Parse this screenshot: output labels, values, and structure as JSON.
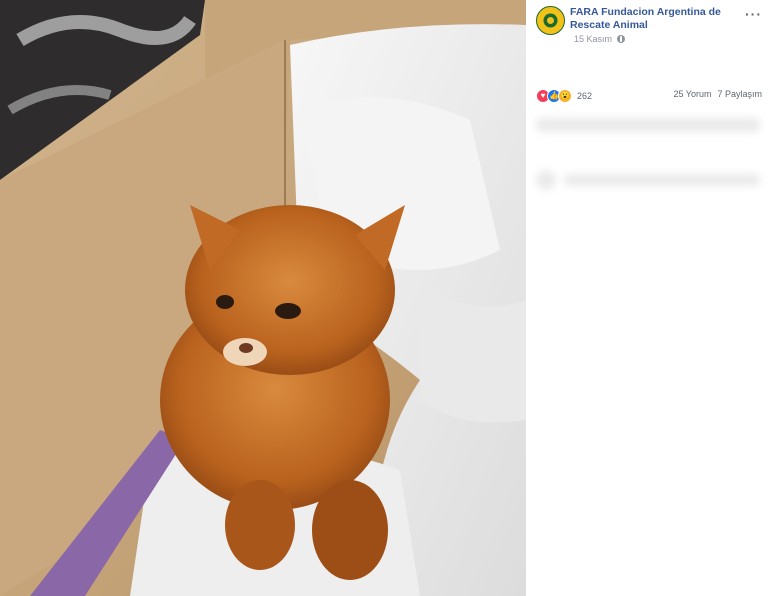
{
  "post": {
    "page_name": "FARA Fundacion Argentina de Rescate Animal",
    "date": "15 Kasım",
    "privacy_icon": "globe-icon",
    "more_icon": "more-options-icon"
  },
  "stats": {
    "reaction_icons": [
      "love-reaction-icon",
      "like-reaction-icon",
      "wow-reaction-icon"
    ],
    "reaction_count": "262",
    "comments": "25 Yorum",
    "shares": "7 Paylaşım"
  },
  "colors": {
    "page_name": "#365899",
    "meta_text": "#90949c"
  }
}
